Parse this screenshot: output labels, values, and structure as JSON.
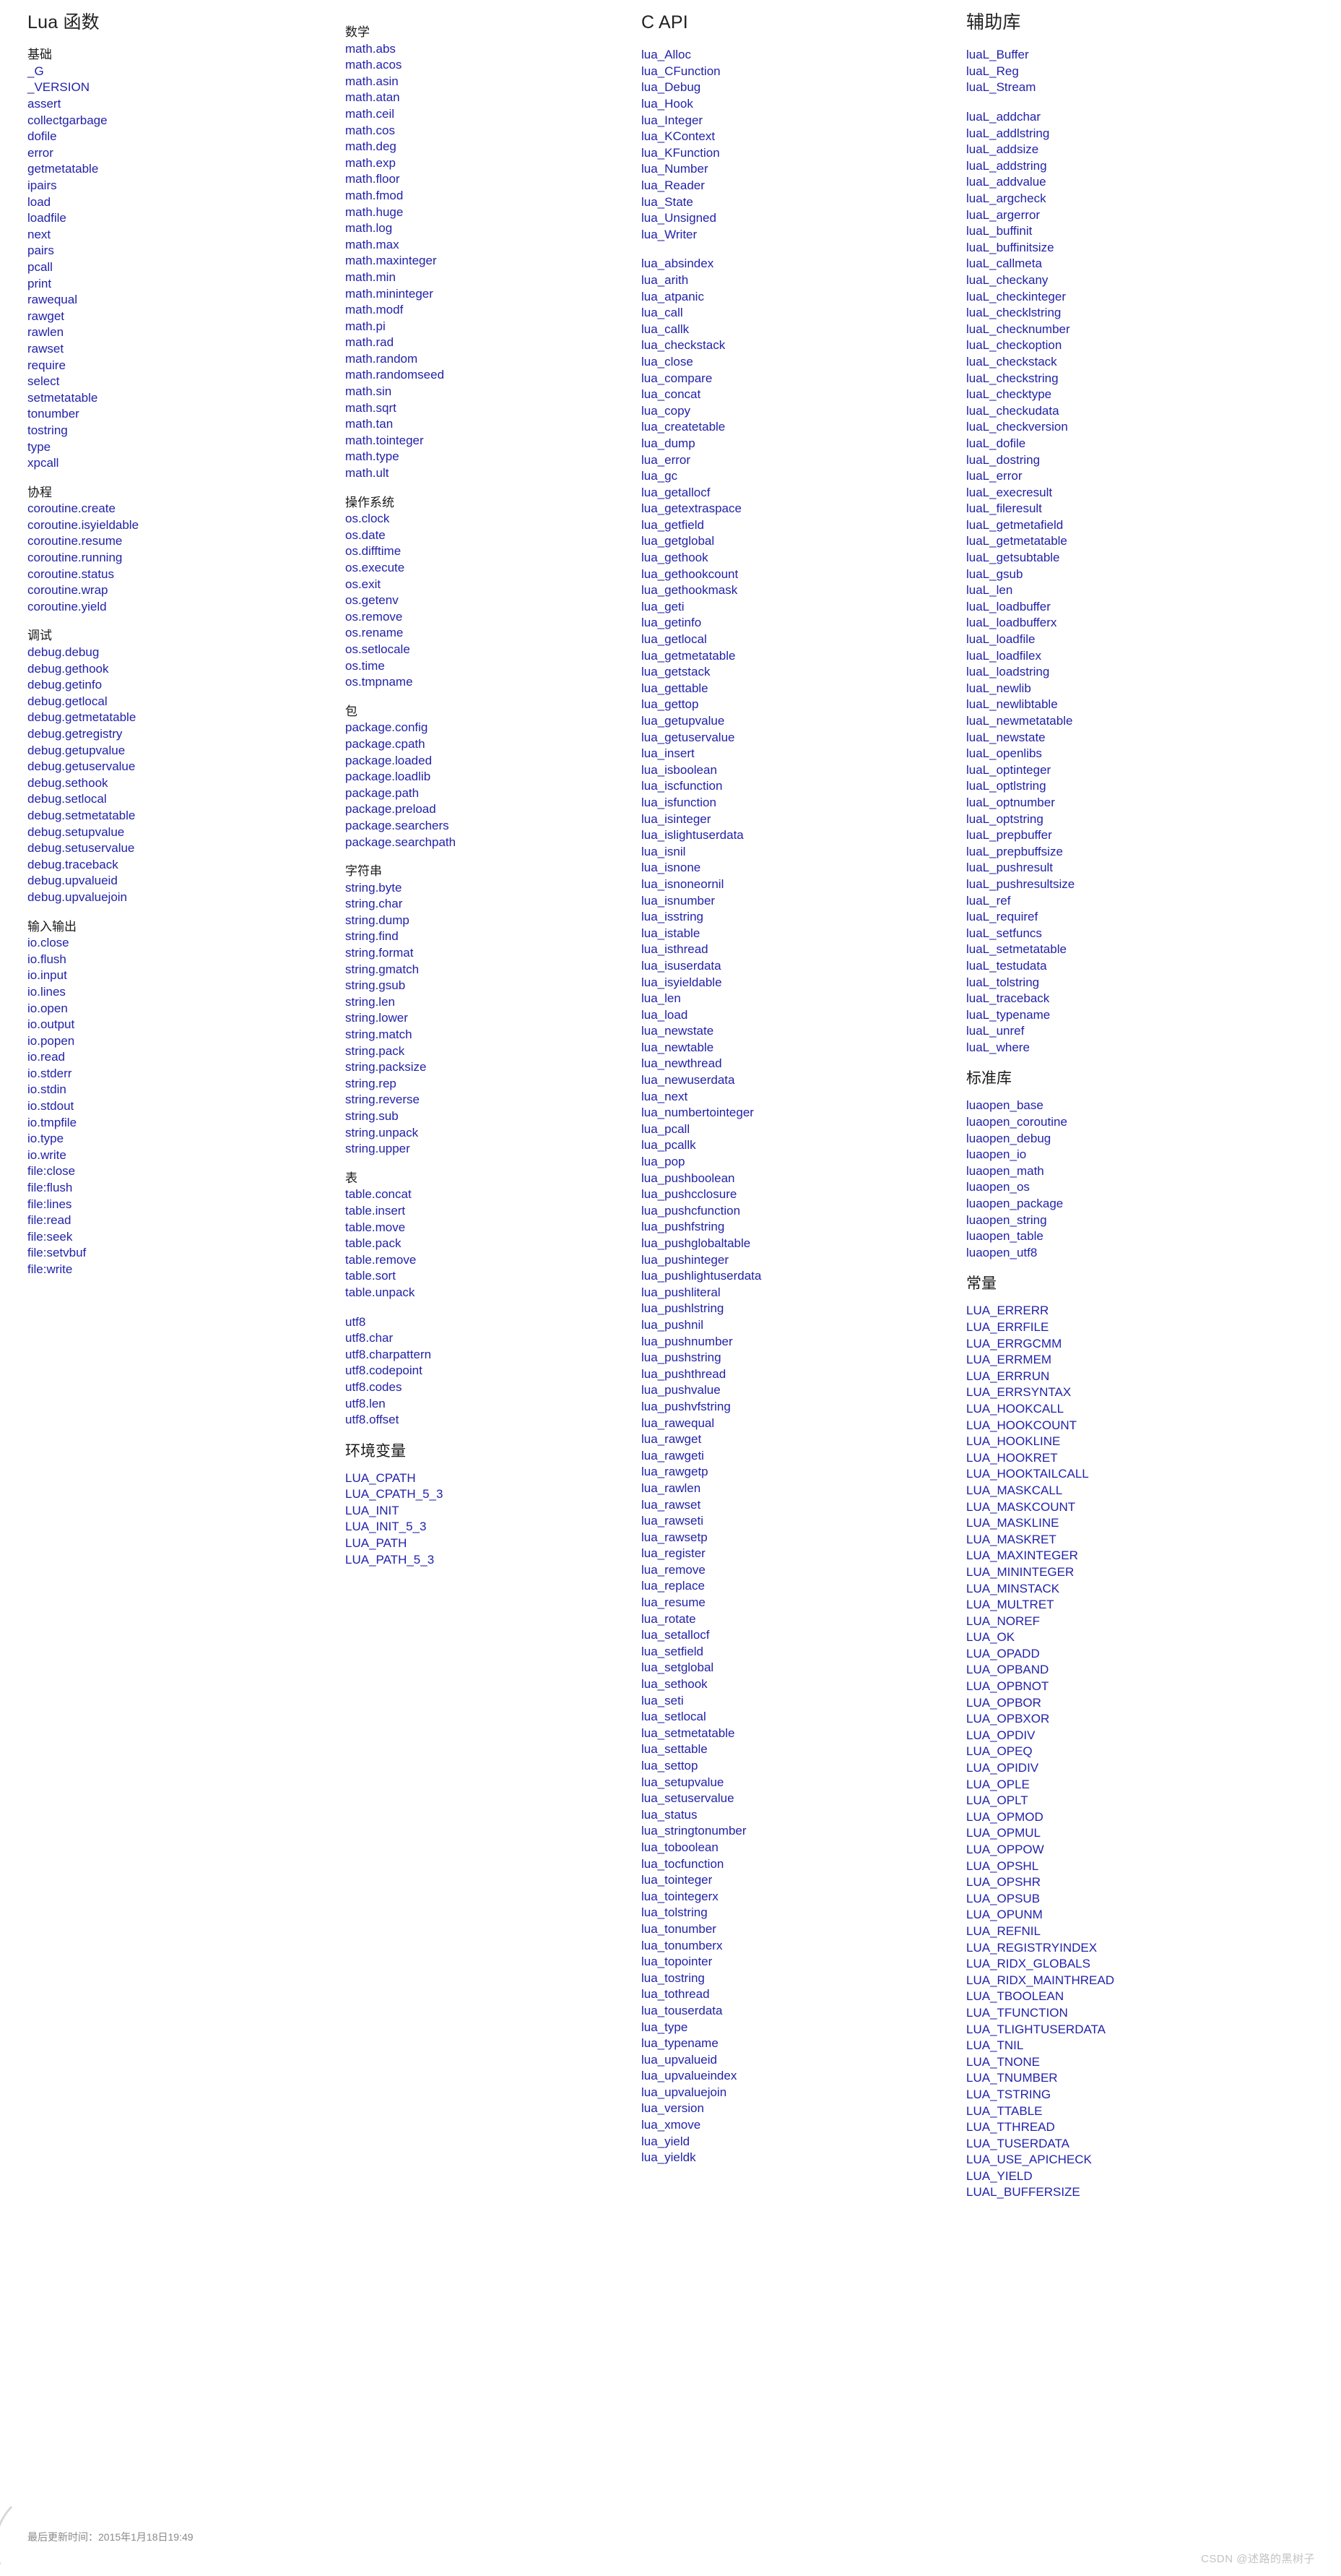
{
  "page": {
    "footer_text": "最后更新时间：2015年1月18日19:49",
    "watermark": "CSDN @述路的黑树子",
    "link_color": "#2222aa",
    "heading_color": "#1a1a1a",
    "background_color": "#ffffff"
  },
  "columns": [
    {
      "title": "Lua 函数",
      "groups": [
        {
          "heading": "基础",
          "entries": [
            "_G",
            "_VERSION",
            "assert",
            "collectgarbage",
            "dofile",
            "error",
            "getmetatable",
            "ipairs",
            "load",
            "loadfile",
            "next",
            "pairs",
            "pcall",
            "print",
            "rawequal",
            "rawget",
            "rawlen",
            "rawset",
            "require",
            "select",
            "setmetatable",
            "tonumber",
            "tostring",
            "type",
            "xpcall"
          ]
        },
        {
          "heading": "协程",
          "entries": [
            "coroutine.create",
            "coroutine.isyieldable",
            "coroutine.resume",
            "coroutine.running",
            "coroutine.status",
            "coroutine.wrap",
            "coroutine.yield"
          ]
        },
        {
          "heading": "调试",
          "entries": [
            "debug.debug",
            "debug.gethook",
            "debug.getinfo",
            "debug.getlocal",
            "debug.getmetatable",
            "debug.getregistry",
            "debug.getupvalue",
            "debug.getuservalue",
            "debug.sethook",
            "debug.setlocal",
            "debug.setmetatable",
            "debug.setupvalue",
            "debug.setuservalue",
            "debug.traceback",
            "debug.upvalueid",
            "debug.upvaluejoin"
          ]
        },
        {
          "heading": "输入输出",
          "entries": [
            "io.close",
            "io.flush",
            "io.input",
            "io.lines",
            "io.open",
            "io.output",
            "io.popen",
            "io.read",
            "io.stderr",
            "io.stdin",
            "io.stdout",
            "io.tmpfile",
            "io.type",
            "io.write",
            "file:close",
            "file:flush",
            "file:lines",
            "file:read",
            "file:seek",
            "file:setvbuf",
            "file:write"
          ]
        }
      ]
    },
    {
      "title": "",
      "groups": [
        {
          "heading": "数学",
          "entries": [
            "math.abs",
            "math.acos",
            "math.asin",
            "math.atan",
            "math.ceil",
            "math.cos",
            "math.deg",
            "math.exp",
            "math.floor",
            "math.fmod",
            "math.huge",
            "math.log",
            "math.max",
            "math.maxinteger",
            "math.min",
            "math.mininteger",
            "math.modf",
            "math.pi",
            "math.rad",
            "math.random",
            "math.randomseed",
            "math.sin",
            "math.sqrt",
            "math.tan",
            "math.tointeger",
            "math.type",
            "math.ult"
          ]
        },
        {
          "heading": "操作系统",
          "entries": [
            "os.clock",
            "os.date",
            "os.difftime",
            "os.execute",
            "os.exit",
            "os.getenv",
            "os.remove",
            "os.rename",
            "os.setlocale",
            "os.time",
            "os.tmpname"
          ]
        },
        {
          "heading": "包",
          "entries": [
            "package.config",
            "package.cpath",
            "package.loaded",
            "package.loadlib",
            "package.path",
            "package.preload",
            "package.searchers",
            "package.searchpath"
          ]
        },
        {
          "heading": "字符串",
          "entries": [
            "string.byte",
            "string.char",
            "string.dump",
            "string.find",
            "string.format",
            "string.gmatch",
            "string.gsub",
            "string.len",
            "string.lower",
            "string.match",
            "string.pack",
            "string.packsize",
            "string.rep",
            "string.reverse",
            "string.sub",
            "string.unpack",
            "string.upper"
          ]
        },
        {
          "heading": "表",
          "entries": [
            "table.concat",
            "table.insert",
            "table.move",
            "table.pack",
            "table.remove",
            "table.sort",
            "table.unpack"
          ]
        },
        {
          "heading": "utf8",
          "is_link_heading": true,
          "entries": [
            "utf8.char",
            "utf8.charpattern",
            "utf8.codepoint",
            "utf8.codes",
            "utf8.len",
            "utf8.offset"
          ]
        },
        {
          "heading": "环境变量",
          "big": true,
          "entries": [
            "LUA_CPATH",
            "LUA_CPATH_5_3",
            "LUA_INIT",
            "LUA_INIT_5_3",
            "LUA_PATH",
            "LUA_PATH_5_3"
          ]
        }
      ]
    },
    {
      "title": "C API",
      "groups": [
        {
          "heading": "",
          "entries": [
            "lua_Alloc",
            "lua_CFunction",
            "lua_Debug",
            "lua_Hook",
            "lua_Integer",
            "lua_KContext",
            "lua_KFunction",
            "lua_Number",
            "lua_Reader",
            "lua_State",
            "lua_Unsigned",
            "lua_Writer"
          ]
        },
        {
          "heading": "",
          "entries": [
            "lua_absindex",
            "lua_arith",
            "lua_atpanic",
            "lua_call",
            "lua_callk",
            "lua_checkstack",
            "lua_close",
            "lua_compare",
            "lua_concat",
            "lua_copy",
            "lua_createtable",
            "lua_dump",
            "lua_error",
            "lua_gc",
            "lua_getallocf",
            "lua_getextraspace",
            "lua_getfield",
            "lua_getglobal",
            "lua_gethook",
            "lua_gethookcount",
            "lua_gethookmask",
            "lua_geti",
            "lua_getinfo",
            "lua_getlocal",
            "lua_getmetatable",
            "lua_getstack",
            "lua_gettable",
            "lua_gettop",
            "lua_getupvalue",
            "lua_getuservalue",
            "lua_insert",
            "lua_isboolean",
            "lua_iscfunction",
            "lua_isfunction",
            "lua_isinteger",
            "lua_islightuserdata",
            "lua_isnil",
            "lua_isnone",
            "lua_isnoneornil",
            "lua_isnumber",
            "lua_isstring",
            "lua_istable",
            "lua_isthread",
            "lua_isuserdata",
            "lua_isyieldable",
            "lua_len",
            "lua_load",
            "lua_newstate",
            "lua_newtable",
            "lua_newthread",
            "lua_newuserdata",
            "lua_next",
            "lua_numbertointeger",
            "lua_pcall",
            "lua_pcallk",
            "lua_pop",
            "lua_pushboolean",
            "lua_pushcclosure",
            "lua_pushcfunction",
            "lua_pushfstring",
            "lua_pushglobaltable",
            "lua_pushinteger",
            "lua_pushlightuserdata",
            "lua_pushliteral",
            "lua_pushlstring",
            "lua_pushnil",
            "lua_pushnumber",
            "lua_pushstring",
            "lua_pushthread",
            "lua_pushvalue",
            "lua_pushvfstring",
            "lua_rawequal",
            "lua_rawget",
            "lua_rawgeti",
            "lua_rawgetp",
            "lua_rawlen",
            "lua_rawset",
            "lua_rawseti",
            "lua_rawsetp",
            "lua_register",
            "lua_remove",
            "lua_replace",
            "lua_resume",
            "lua_rotate",
            "lua_setallocf",
            "lua_setfield",
            "lua_setglobal",
            "lua_sethook",
            "lua_seti",
            "lua_setlocal",
            "lua_setmetatable",
            "lua_settable",
            "lua_settop",
            "lua_setupvalue",
            "lua_setuservalue",
            "lua_status",
            "lua_stringtonumber",
            "lua_toboolean",
            "lua_tocfunction",
            "lua_tointeger",
            "lua_tointegerx",
            "lua_tolstring",
            "lua_tonumber",
            "lua_tonumberx",
            "lua_topointer",
            "lua_tostring",
            "lua_tothread",
            "lua_touserdata",
            "lua_type",
            "lua_typename",
            "lua_upvalueid",
            "lua_upvalueindex",
            "lua_upvaluejoin",
            "lua_version",
            "lua_xmove",
            "lua_yield",
            "lua_yieldk"
          ]
        }
      ]
    },
    {
      "title": "辅助库",
      "groups": [
        {
          "heading": "",
          "entries": [
            "luaL_Buffer",
            "luaL_Reg",
            "luaL_Stream"
          ]
        },
        {
          "heading": "",
          "entries": [
            "luaL_addchar",
            "luaL_addlstring",
            "luaL_addsize",
            "luaL_addstring",
            "luaL_addvalue",
            "luaL_argcheck",
            "luaL_argerror",
            "luaL_buffinit",
            "luaL_buffinitsize",
            "luaL_callmeta",
            "luaL_checkany",
            "luaL_checkinteger",
            "luaL_checklstring",
            "luaL_checknumber",
            "luaL_checkoption",
            "luaL_checkstack",
            "luaL_checkstring",
            "luaL_checktype",
            "luaL_checkudata",
            "luaL_checkversion",
            "luaL_dofile",
            "luaL_dostring",
            "luaL_error",
            "luaL_execresult",
            "luaL_fileresult",
            "luaL_getmetafield",
            "luaL_getmetatable",
            "luaL_getsubtable",
            "luaL_gsub",
            "luaL_len",
            "luaL_loadbuffer",
            "luaL_loadbufferx",
            "luaL_loadfile",
            "luaL_loadfilex",
            "luaL_loadstring",
            "luaL_newlib",
            "luaL_newlibtable",
            "luaL_newmetatable",
            "luaL_newstate",
            "luaL_openlibs",
            "luaL_optinteger",
            "luaL_optlstring",
            "luaL_optnumber",
            "luaL_optstring",
            "luaL_prepbuffer",
            "luaL_prepbuffsize",
            "luaL_pushresult",
            "luaL_pushresultsize",
            "luaL_ref",
            "luaL_requiref",
            "luaL_setfuncs",
            "luaL_setmetatable",
            "luaL_testudata",
            "luaL_tolstring",
            "luaL_traceback",
            "luaL_typename",
            "luaL_unref",
            "luaL_where"
          ]
        },
        {
          "heading": "标准库",
          "big": true,
          "entries": [
            "luaopen_base",
            "luaopen_coroutine",
            "luaopen_debug",
            "luaopen_io",
            "luaopen_math",
            "luaopen_os",
            "luaopen_package",
            "luaopen_string",
            "luaopen_table",
            "luaopen_utf8"
          ]
        },
        {
          "heading": "常量",
          "big": true,
          "entries": [
            "LUA_ERRERR",
            "LUA_ERRFILE",
            "LUA_ERRGCMM",
            "LUA_ERRMEM",
            "LUA_ERRRUN",
            "LUA_ERRSYNTAX",
            "LUA_HOOKCALL",
            "LUA_HOOKCOUNT",
            "LUA_HOOKLINE",
            "LUA_HOOKRET",
            "LUA_HOOKTAILCALL",
            "LUA_MASKCALL",
            "LUA_MASKCOUNT",
            "LUA_MASKLINE",
            "LUA_MASKRET",
            "LUA_MAXINTEGER",
            "LUA_MININTEGER",
            "LUA_MINSTACK",
            "LUA_MULTRET",
            "LUA_NOREF",
            "LUA_OK",
            "LUA_OPADD",
            "LUA_OPBAND",
            "LUA_OPBNOT",
            "LUA_OPBOR",
            "LUA_OPBXOR",
            "LUA_OPDIV",
            "LUA_OPEQ",
            "LUA_OPIDIV",
            "LUA_OPLE",
            "LUA_OPLT",
            "LUA_OPMOD",
            "LUA_OPMUL",
            "LUA_OPPOW",
            "LUA_OPSHL",
            "LUA_OPSHR",
            "LUA_OPSUB",
            "LUA_OPUNM",
            "LUA_REFNIL",
            "LUA_REGISTRYINDEX",
            "LUA_RIDX_GLOBALS",
            "LUA_RIDX_MAINTHREAD",
            "LUA_TBOOLEAN",
            "LUA_TFUNCTION",
            "LUA_TLIGHTUSERDATA",
            "LUA_TNIL",
            "LUA_TNONE",
            "LUA_TNUMBER",
            "LUA_TSTRING",
            "LUA_TTABLE",
            "LUA_TTHREAD",
            "LUA_TUSERDATA",
            "LUA_USE_APICHECK",
            "LUA_YIELD",
            "LUAL_BUFFERSIZE"
          ]
        }
      ]
    }
  ]
}
